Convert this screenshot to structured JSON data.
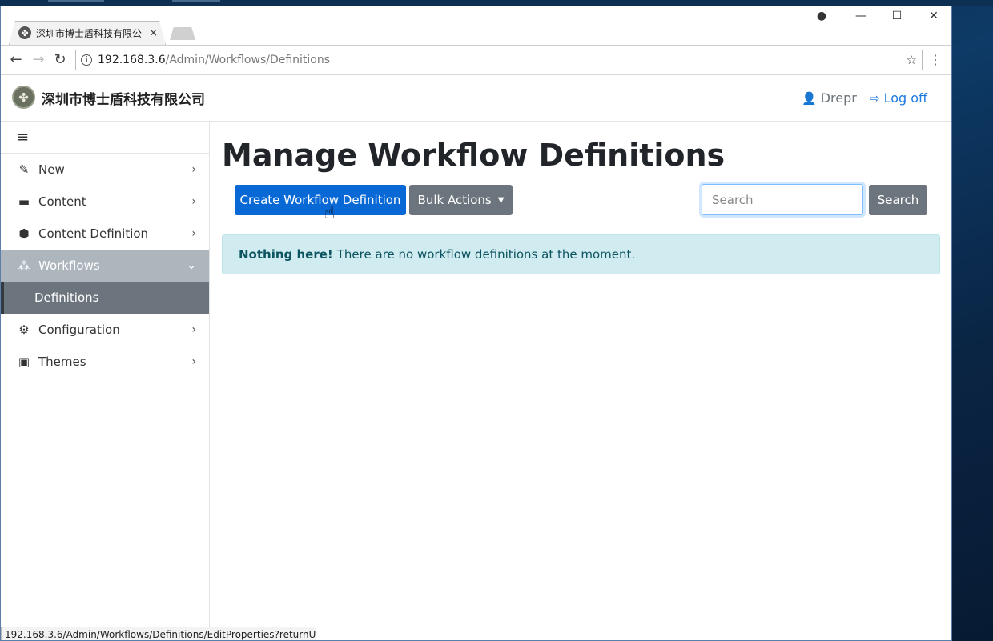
{
  "browser": {
    "tab_title": "深圳市博士盾科技有限公",
    "tab_close": "×",
    "controls": {
      "account": "●",
      "minimize": "—",
      "maximize": "☐",
      "close": "✕"
    },
    "nav": {
      "back": "←",
      "forward": "→",
      "reload": "↻"
    },
    "url_host": "192.168.3.6",
    "url_path": "/Admin/Workflows/Definitions",
    "info_icon": "i",
    "star": "☆",
    "menu": "⋮",
    "status_url": "192.168.3.6/Admin/Workflows/Definitions/EditProperties?returnU..."
  },
  "header": {
    "brand": "深圳市博士盾科技有限公司",
    "logo_glyph": "✤",
    "user_icon": "👤",
    "user_name": "Drepr",
    "logoff_icon": "⇨",
    "logoff_label": "Log off"
  },
  "sidebar": {
    "toggle": "≡",
    "items": [
      {
        "label": "New",
        "icon": "✎",
        "chevron": "›"
      },
      {
        "label": "Content",
        "icon": "▬",
        "chevron": "›"
      },
      {
        "label": "Content Definition",
        "icon": "⬢",
        "chevron": "›"
      },
      {
        "label": "Workflows",
        "icon": "⁂",
        "chevron": "⌄"
      },
      {
        "label": "Definitions"
      },
      {
        "label": "Configuration",
        "icon": "⚙",
        "chevron": "›"
      },
      {
        "label": "Themes",
        "icon": "▣",
        "chevron": "›"
      }
    ]
  },
  "main": {
    "title": "Manage Workflow Definitions",
    "create_button": "Create Workflow Definition",
    "bulk_button": "Bulk Actions",
    "bulk_caret": "▼",
    "search_placeholder": "Search",
    "search_button": "Search",
    "alert_strong": "Nothing here!",
    "alert_text": "There are no workflow definitions at the moment."
  },
  "colors": {
    "primary": "#0869d6",
    "secondary": "#6c757d",
    "link": "#1e7be0",
    "alert_bg": "#d1ecf1",
    "active_nav": "#adb5bd"
  }
}
